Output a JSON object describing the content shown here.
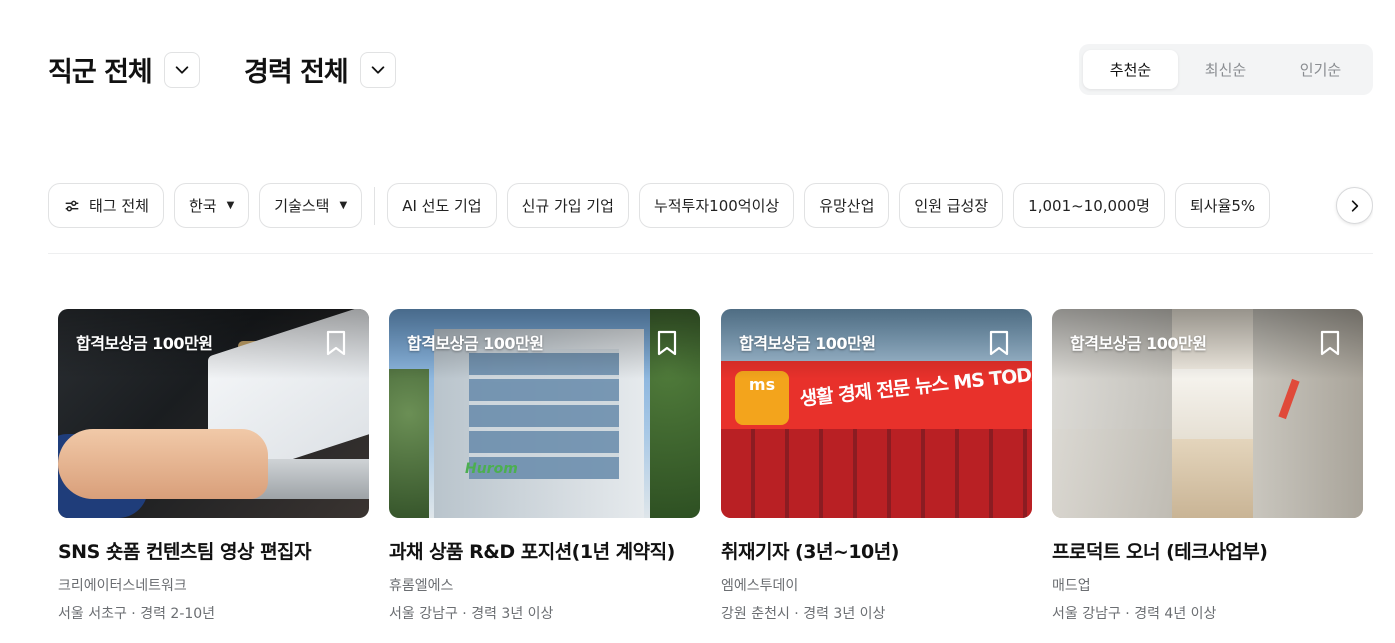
{
  "filters": {
    "job_category": "직군 전체",
    "career": "경력 전체"
  },
  "sort": {
    "options": [
      "추천순",
      "최신순",
      "인기순"
    ],
    "selected": "추천순"
  },
  "tags": {
    "all_label": "태그 전체",
    "country": "한국",
    "tech_stack": "기술스택",
    "items": [
      "AI 선도 기업",
      "신규 가입 기업",
      "누적투자100억이상",
      "유망산업",
      "인원 급성장",
      "1,001~10,000명",
      "퇴사율5%"
    ]
  },
  "jobs": [
    {
      "reward": "합격보상금 100만원",
      "title": "SNS 숏폼 컨텐츠팀 영상 편집자",
      "company": "크리에이터스네트워크",
      "meta": "서울 서초구 · 경력 2-10년"
    },
    {
      "reward": "합격보상금 100만원",
      "title": "과채 상품 R&D 포지션(1년 계약직)",
      "company": "휴롬엘에스",
      "meta": "서울 강남구 · 경력 3년 이상",
      "image_text": "Hurom"
    },
    {
      "reward": "합격보상금 100만원",
      "title": "취재기자 (3년~10년)",
      "company": "엠에스투데이",
      "meta": "강원 춘천시 · 경력 3년 이상",
      "image_text": "생활 경제 전문 뉴스 MS TODAY",
      "image_badge": "ms"
    },
    {
      "reward": "합격보상금 100만원",
      "title": "프로덕트 오너 (테크사업부)",
      "company": "매드업",
      "meta": "서울 강남구 · 경력 4년 이상"
    }
  ]
}
